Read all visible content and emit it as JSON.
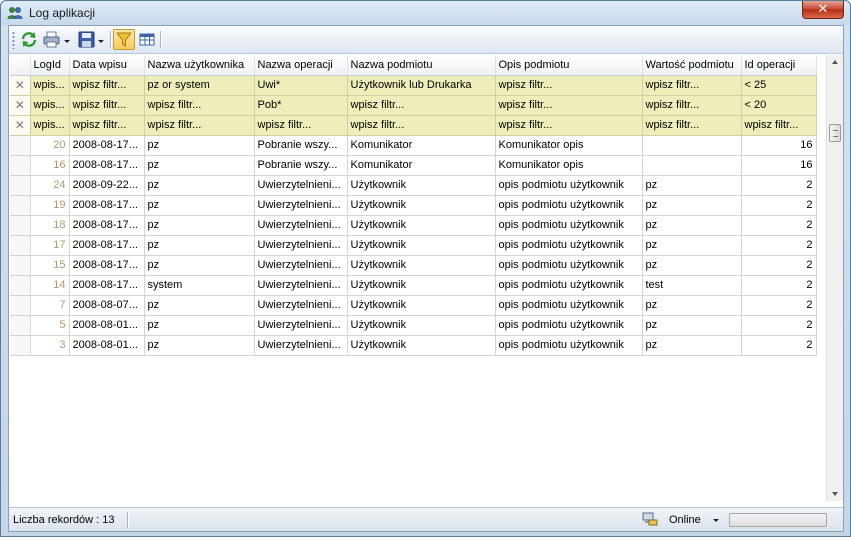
{
  "window": {
    "title": "Log aplikacji",
    "close_label": "✕"
  },
  "toolbar": {
    "buttons": [
      {
        "name": "refresh-button",
        "icon": "refresh-icon"
      },
      {
        "name": "print-button",
        "icon": "printer-icon"
      },
      {
        "name": "save-button",
        "icon": "floppy-disk-icon"
      },
      {
        "name": "filter-toggle-button",
        "icon": "filter-funnel-icon"
      },
      {
        "name": "columns-button",
        "icon": "table-icon"
      }
    ]
  },
  "grid": {
    "columns": [
      "LogId",
      "Data wpisu",
      "Nazwa użytkownika",
      "Nazwa operacji",
      "Nazwa podmiotu",
      "Opis podmiotu",
      "Wartość podmiotu",
      "Id operacji"
    ],
    "filters": [
      [
        "wpis...",
        "wpisz filtr...",
        "pz or system",
        "Uwi*",
        "Użytkownik lub Drukarka",
        "wpisz filtr...",
        "wpisz filtr...",
        "< 25"
      ],
      [
        "wpis...",
        "wpisz filtr...",
        "wpisz filtr...",
        "Pob*",
        "wpisz filtr...",
        "wpisz filtr...",
        "wpisz filtr...",
        "< 20"
      ],
      [
        "wpis...",
        "wpisz filtr...",
        "wpisz filtr...",
        "wpisz filtr...",
        "wpisz filtr...",
        "wpisz filtr...",
        "wpisz filtr...",
        "wpisz filtr..."
      ]
    ],
    "rows": [
      [
        "20",
        "2008-08-17...",
        "pz",
        "Pobranie wszy...",
        "Komunikator",
        "Komunikator opis",
        "",
        "16"
      ],
      [
        "16",
        "2008-08-17...",
        "pz",
        "Pobranie wszy...",
        "Komunikator",
        "Komunikator opis",
        "",
        "16"
      ],
      [
        "24",
        "2008-09-22...",
        "pz",
        "Uwierzytelnieni...",
        "Użytkownik",
        "opis podmiotu użytkownik",
        "pz",
        "2"
      ],
      [
        "19",
        "2008-08-17...",
        "pz",
        "Uwierzytelnieni...",
        "Użytkownik",
        "opis podmiotu użytkownik",
        "pz",
        "2"
      ],
      [
        "18",
        "2008-08-17...",
        "pz",
        "Uwierzytelnieni...",
        "Użytkownik",
        "opis podmiotu użytkownik",
        "pz",
        "2"
      ],
      [
        "17",
        "2008-08-17...",
        "pz",
        "Uwierzytelnieni...",
        "Użytkownik",
        "opis podmiotu użytkownik",
        "pz",
        "2"
      ],
      [
        "15",
        "2008-08-17...",
        "pz",
        "Uwierzytelnieni...",
        "Użytkownik",
        "opis podmiotu użytkownik",
        "pz",
        "2"
      ],
      [
        "14",
        "2008-08-17...",
        "system",
        "Uwierzytelnieni...",
        "Użytkownik",
        "opis podmiotu użytkownik",
        "test",
        "2"
      ],
      [
        "7",
        "2008-08-07...",
        "pz",
        "Uwierzytelnieni...",
        "Użytkownik",
        "opis podmiotu użytkownik",
        "pz",
        "2"
      ],
      [
        "5",
        "2008-08-01...",
        "pz",
        "Uwierzytelnieni...",
        "Użytkownik",
        "opis podmiotu użytkownik",
        "pz",
        "2"
      ],
      [
        "3",
        "2008-08-01...",
        "pz",
        "Uwierzytelnieni...",
        "Użytkownik",
        "opis podmiotu użytkownik",
        "pz",
        "2"
      ]
    ]
  },
  "statusbar": {
    "record_count": "Liczba rekordów : 13",
    "connection": "Online"
  },
  "colors": {
    "filter_row": "#efeeba",
    "logid_text": "#ad9a6c",
    "accent": "#f8c859"
  }
}
